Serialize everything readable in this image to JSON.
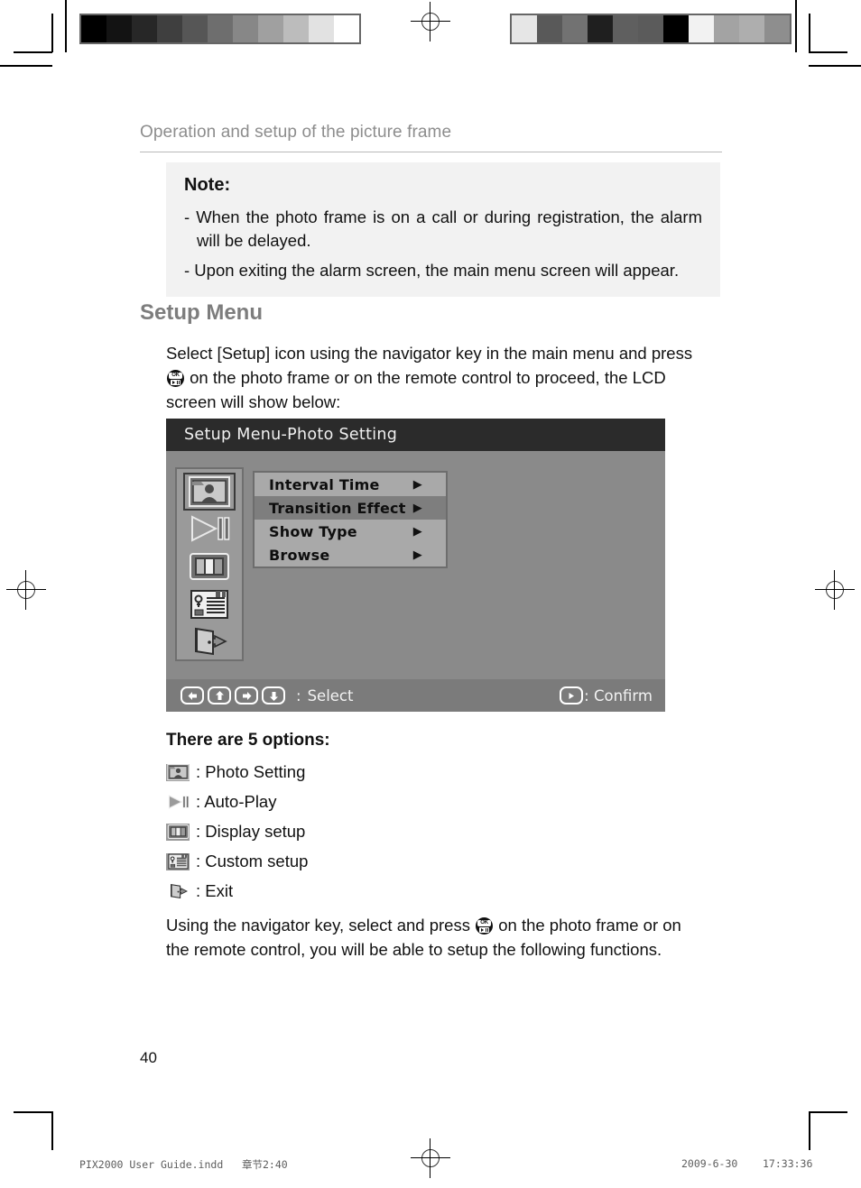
{
  "document": {
    "running_head": "Operation and setup of the picture frame",
    "page_number": "40"
  },
  "note": {
    "title": "Note:",
    "items": [
      "- When the photo frame is on a call or during registration, the alarm will be delayed.",
      "- Upon exiting the alarm screen, the main menu screen will appear."
    ]
  },
  "setup_section": {
    "heading": "Setup Menu",
    "intro_before_icon": "Select [Setup] icon using the navigator key in the main menu and press",
    "intro_icon": "ok-button-icon",
    "intro_after_icon": "on the photo frame or on the remote control to proceed, the LCD screen will show below:",
    "outro_before_icon": "Using the navigator key, select and press",
    "outro_icon": "ok-button-icon",
    "outro_after_icon": "on the photo frame or on the remote control, you will be able to setup the following functions."
  },
  "lcd": {
    "title": "Setup Menu-Photo Setting",
    "icon_rail": [
      {
        "name": "photo-setting-icon",
        "selected": true
      },
      {
        "name": "auto-play-icon",
        "selected": false
      },
      {
        "name": "display-setup-icon",
        "selected": false
      },
      {
        "name": "custom-setup-icon",
        "selected": false
      },
      {
        "name": "exit-icon",
        "selected": false
      }
    ],
    "menu_items": [
      {
        "label": "Interval Time",
        "arrow": "▶",
        "active": false
      },
      {
        "label": "Transition Effect",
        "arrow": "▶",
        "active": true
      },
      {
        "label": "Show Type",
        "arrow": "▶",
        "active": false
      },
      {
        "label": "Browse",
        "arrow": "▶",
        "active": false
      }
    ],
    "footer": {
      "keys": [
        "left-arrow-icon",
        "up-arrow-icon",
        "right-arrow-icon",
        "down-arrow-icon"
      ],
      "select_separator": ":",
      "select_label": "Select",
      "confirm_key": "play-arrow-icon",
      "confirm_label": ": Confirm"
    },
    "colors": {
      "title_bar": "#2b2b2b",
      "body": "#8a8a8a",
      "panel": "#a9a9a9",
      "highlight": "#7e7e7e",
      "footer_bar": "#7b7b7b"
    }
  },
  "options": {
    "title": "There are 5 options:",
    "items": [
      {
        "icon": "photo-setting-icon",
        "label": ": Photo Setting"
      },
      {
        "icon": "auto-play-icon",
        "label": ": Auto-Play"
      },
      {
        "icon": "display-setup-icon",
        "label": ": Display setup"
      },
      {
        "icon": "custom-setup-icon",
        "label": ": Custom setup"
      },
      {
        "icon": "exit-icon",
        "label": ": Exit"
      }
    ]
  },
  "print_footer": {
    "left": "PIX2000 User Guide.indd   章节2:40",
    "right": "2009-6-30    17:33:36"
  },
  "calibration_bars": {
    "left_swatches": [
      "#000000",
      "#131313",
      "#272727",
      "#3f3f3f",
      "#565656",
      "#6e6e6e",
      "#878787",
      "#a0a0a0",
      "#bcbcbc",
      "#e2e2e2",
      "#ffffff"
    ],
    "right_swatches": [
      "#e6e6e6",
      "#595959",
      "#727272",
      "#1f1f1f",
      "#5f5f5f",
      "#5b5b5b",
      "#000000",
      "#f2f2f2",
      "#a3a3a3",
      "#aeaeae",
      "#8e8e8e"
    ]
  }
}
